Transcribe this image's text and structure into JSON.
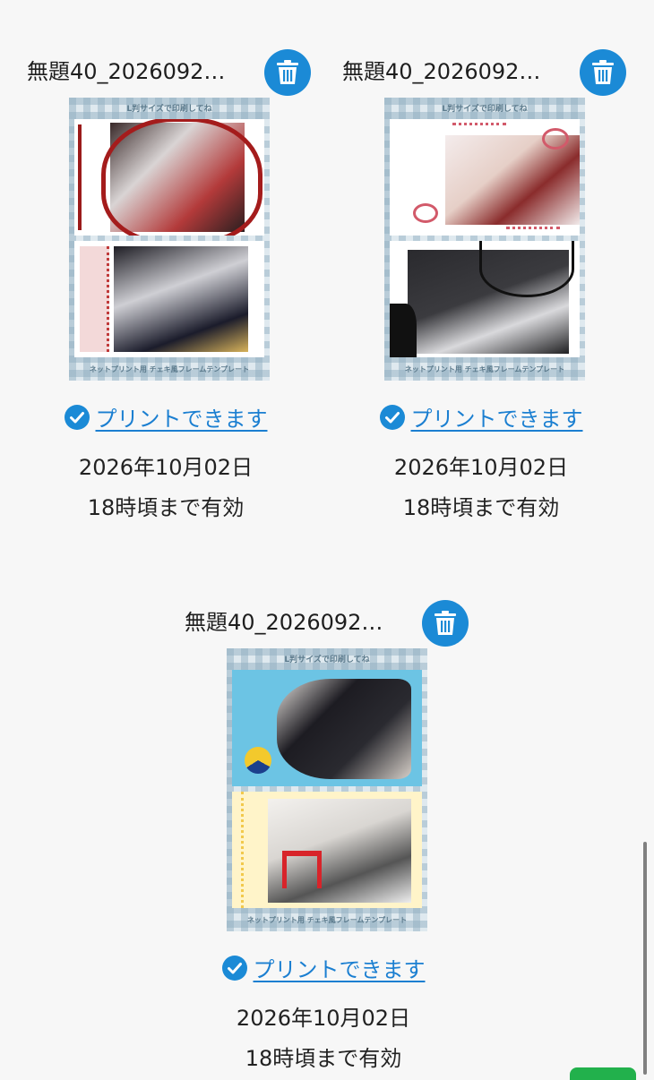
{
  "items": [
    {
      "title": "無題40_2026092…",
      "thumb_top": "L判サイズで印刷してね",
      "thumb_bottom": "ネットプリント用 チェキ風フレームテンプレート",
      "print_link": "プリントできます",
      "date": "2026年10月02日",
      "expire": "18時頃まで有効"
    },
    {
      "title": "無題40_2026092…",
      "thumb_top": "L判サイズで印刷してね",
      "thumb_bottom": "ネットプリント用 チェキ風フレームテンプレート",
      "print_link": "プリントできます",
      "date": "2026年10月02日",
      "expire": "18時頃まで有効"
    },
    {
      "title": "無題40_2026092…",
      "thumb_top": "L判サイズで印刷してね",
      "thumb_bottom": "ネットプリント用 チェキ風フレームテンプレート",
      "print_link": "プリントできます",
      "date": "2026年10月02日",
      "expire": "18時頃まで有効"
    }
  ],
  "icons": {
    "delete": "trash-icon",
    "status": "check-circle-icon"
  },
  "colors": {
    "accent": "#1b8ad6",
    "link": "#1b7fd1",
    "background": "#f7f7f7"
  }
}
